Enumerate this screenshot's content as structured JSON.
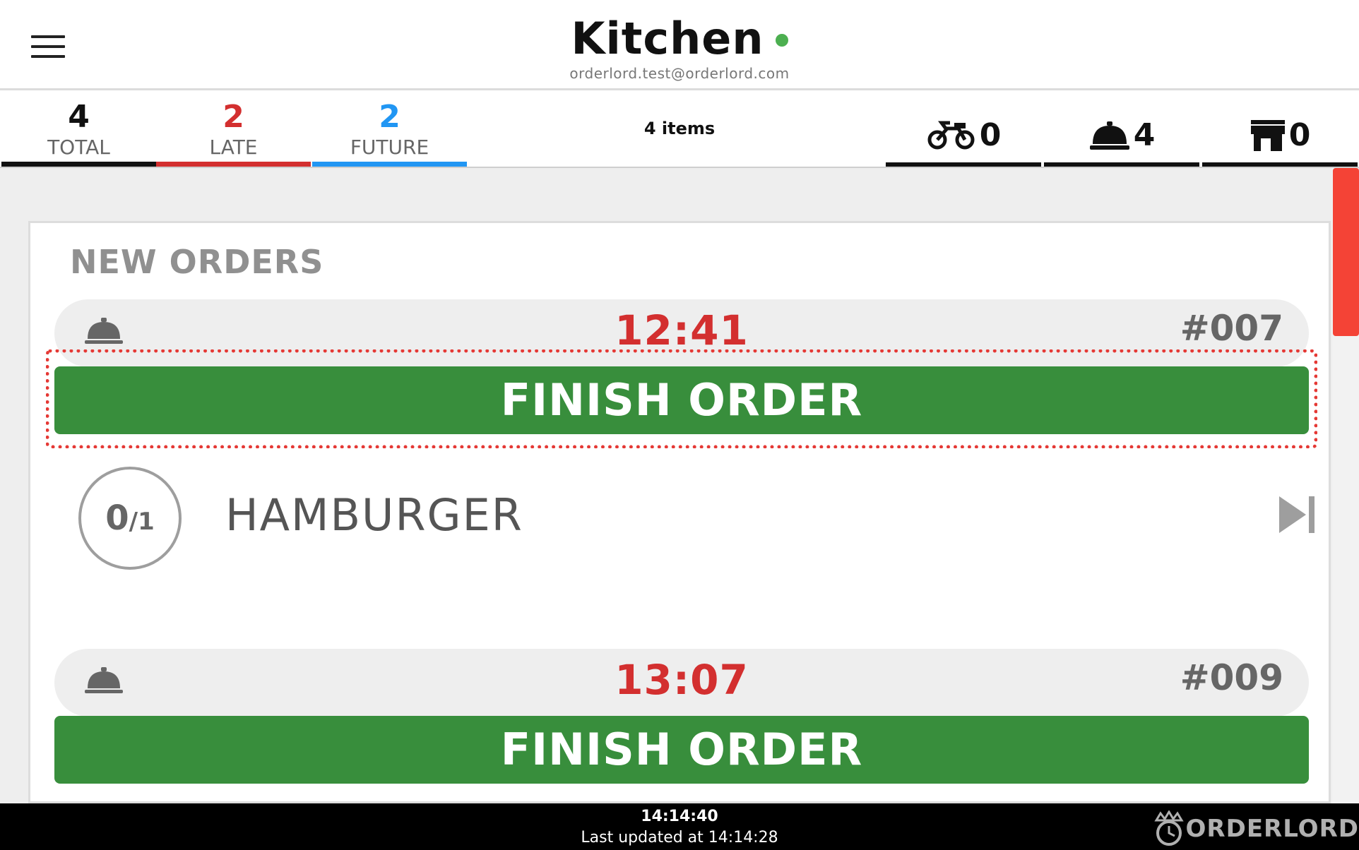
{
  "header": {
    "title": "Kitchen",
    "status_color": "#4caf50",
    "email": "orderlord.test@orderlord.com",
    "menu_icon": "hamburger-menu-icon"
  },
  "stats": {
    "total": {
      "value": "4",
      "label": "TOTAL",
      "color": "#111111"
    },
    "late": {
      "value": "2",
      "label": "LATE",
      "color": "#d32f2f"
    },
    "future": {
      "value": "2",
      "label": "FUTURE",
      "color": "#2196f3"
    },
    "items_count": "4 items",
    "channels": [
      {
        "icon": "motorbike-delivery-icon",
        "count": "0"
      },
      {
        "icon": "service-cloche-icon",
        "count": "4"
      },
      {
        "icon": "storefront-pickup-icon",
        "count": "0"
      }
    ]
  },
  "section": {
    "title": "NEW ORDERS"
  },
  "orders": [
    {
      "service_icon": "service-cloche-icon",
      "time": "12:41",
      "number": "#007",
      "finish_label": "FINISH ORDER",
      "items": [
        {
          "done": "0",
          "total": "1",
          "name": "HAMBURGER",
          "action_icon": "skip-next-icon"
        }
      ]
    },
    {
      "service_icon": "service-cloche-icon",
      "time": "13:07",
      "number": "#009",
      "finish_label": "FINISH ORDER"
    }
  ],
  "footer": {
    "clock": "14:14:40",
    "last_updated": "Last updated at 14:14:28",
    "brand": "ORDERLORD"
  },
  "colors": {
    "accent_green": "#388e3c",
    "late_red": "#d32f2f",
    "future_blue": "#2196f3",
    "scroll_red": "#f44336"
  }
}
